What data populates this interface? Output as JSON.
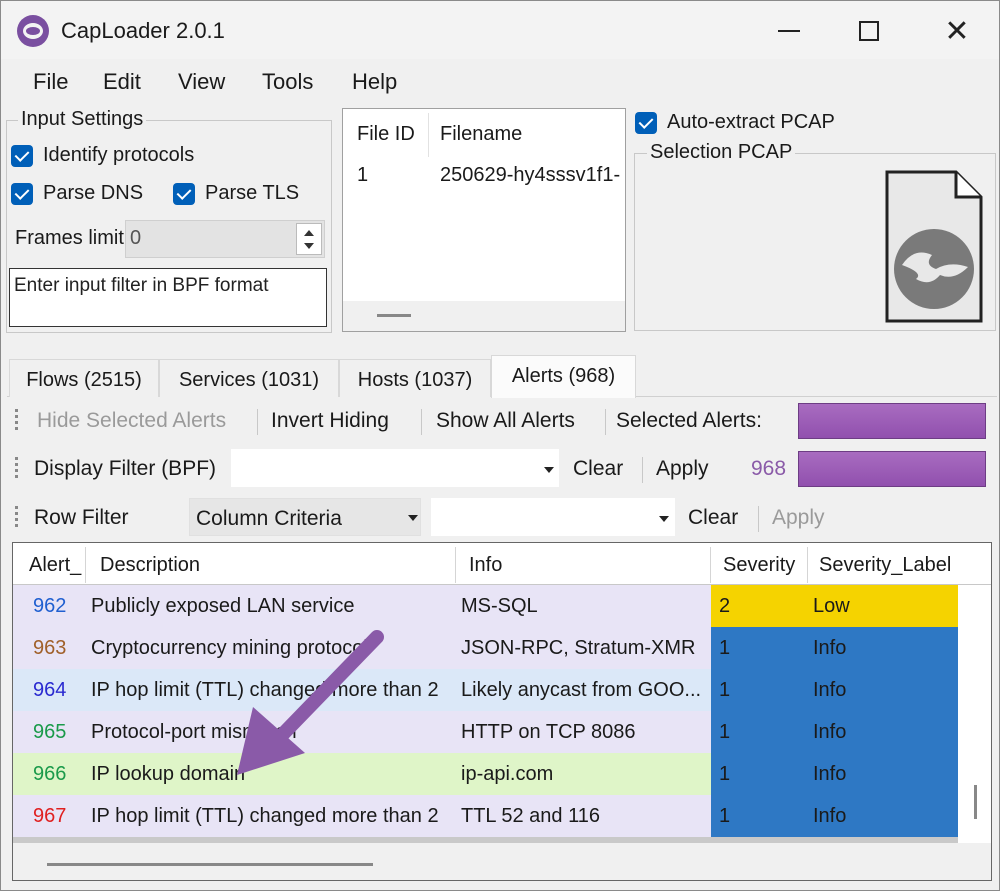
{
  "window": {
    "title": "CapLoader 2.0.1"
  },
  "menu": [
    "File",
    "Edit",
    "View",
    "Tools",
    "Help"
  ],
  "input_settings": {
    "title": "Input Settings",
    "identify_protocols": "Identify protocols",
    "parse_dns": "Parse DNS",
    "parse_tls": "Parse TLS",
    "frames_limit_label": "Frames limit",
    "frames_limit_value": "0",
    "bpf_placeholder": "Enter input filter in BPF format"
  },
  "file_list": {
    "headers": [
      "File ID",
      "Filename"
    ],
    "rows": [
      {
        "id": "1",
        "filename": "250629-hy4sssv1f1-"
      }
    ]
  },
  "auto_extract": "Auto-extract PCAP",
  "selection_pcap": "Selection PCAP",
  "tabs": [
    "Flows (2515)",
    "Services (1031)",
    "Hosts (1037)",
    "Alerts (968)"
  ],
  "toolbar1": {
    "hide_selected": "Hide Selected Alerts",
    "invert_hiding": "Invert Hiding",
    "show_all": "Show All Alerts",
    "selected_alerts": "Selected Alerts:"
  },
  "toolbar2": {
    "display_filter": "Display Filter (BPF)",
    "clear": "Clear",
    "apply": "Apply",
    "count": "968"
  },
  "toolbar3": {
    "row_filter": "Row Filter",
    "column_criteria": "Column Criteria",
    "clear": "Clear",
    "apply": "Apply"
  },
  "grid": {
    "headers": [
      "Alert_",
      "Description",
      "Info",
      "Severity",
      "Severity_Label"
    ],
    "rows": [
      {
        "id": "962",
        "description": "Publicly exposed LAN service",
        "info": "MS-SQL",
        "severity": "2",
        "label": "Low",
        "id_color": "#1f5fd0",
        "row_bg": "#e8e4f6",
        "sev_bg": "#f5d300"
      },
      {
        "id": "963",
        "description": "Cryptocurrency mining protocol",
        "info": "JSON-RPC, Stratum-XMR",
        "severity": "1",
        "label": "Info",
        "id_color": "#a0602a",
        "row_bg": "#e8e4f6",
        "sev_bg": "#2e78c4"
      },
      {
        "id": "964",
        "description": "IP hop limit (TTL) changed more than 2",
        "info": "Likely anycast from GOO...",
        "severity": "1",
        "label": "Info",
        "id_color": "#2a2ad0",
        "row_bg": "#dbe8f8",
        "sev_bg": "#2e78c4"
      },
      {
        "id": "965",
        "description": "Protocol-port mismatch",
        "info": "HTTP on TCP 8086",
        "severity": "1",
        "label": "Info",
        "id_color": "#1a9a4a",
        "row_bg": "#e8e4f6",
        "sev_bg": "#2e78c4"
      },
      {
        "id": "966",
        "description": "IP lookup domain",
        "info": "ip-api.com",
        "severity": "1",
        "label": "Info",
        "id_color": "#1a9a4a",
        "row_bg": "#dff5c8",
        "sev_bg": "#2e78c4"
      },
      {
        "id": "967",
        "description": "IP hop limit (TTL) changed more than 2",
        "info": "TTL 52 and 116",
        "severity": "1",
        "label": "Info",
        "id_color": "#e02020",
        "row_bg": "#e8e4f6",
        "sev_bg": "#2e78c4"
      }
    ]
  },
  "colors": {
    "checkbox": "#005fb8",
    "selection_bar": "#9a5ab5",
    "arrow": "#8a5aa8"
  }
}
